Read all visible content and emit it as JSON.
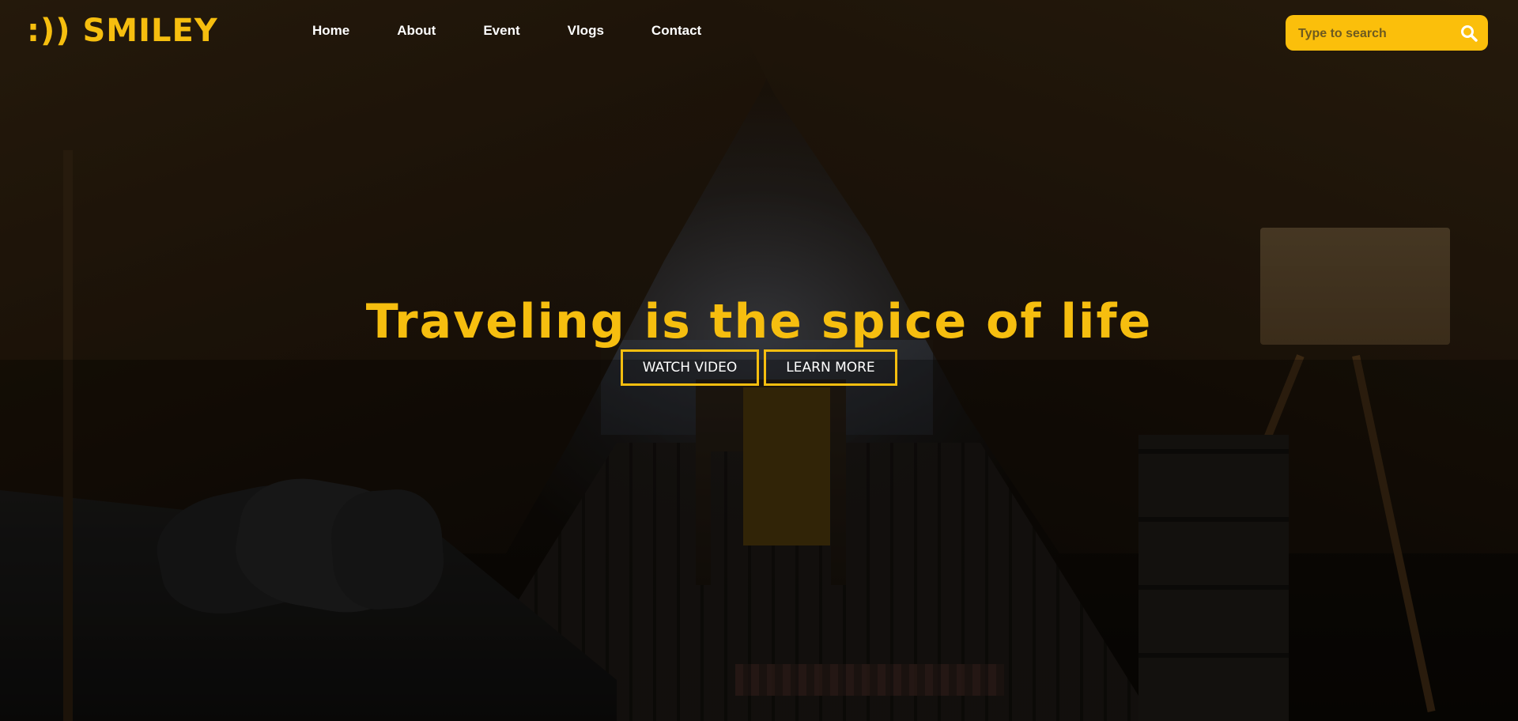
{
  "header": {
    "logo": ":)) SMILEY",
    "nav": [
      {
        "label": "Home"
      },
      {
        "label": "About"
      },
      {
        "label": "Event"
      },
      {
        "label": "Vlogs"
      },
      {
        "label": "Contact"
      }
    ],
    "search": {
      "placeholder": "Type to search",
      "icon": "search-icon"
    }
  },
  "hero": {
    "headline": "Traveling is the spice of life",
    "buttons": {
      "watch_video": "WATCH VIDEO",
      "learn_more": "LEARN MORE"
    },
    "background": "tent-interior-beach-photo"
  },
  "colors": {
    "accent": "#f6be0f",
    "search_bg": "#fbbf0b",
    "nav_text": "#ffffff"
  }
}
